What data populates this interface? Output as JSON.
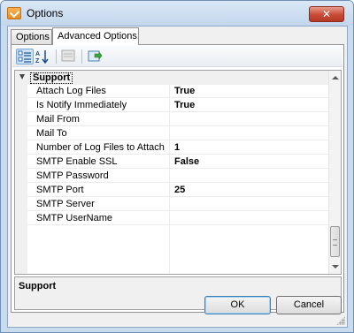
{
  "window": {
    "title": "Options",
    "close_glyph": "✕"
  },
  "tabs": [
    {
      "label": "Options",
      "active": false
    },
    {
      "label": "Advanced Options",
      "active": true
    }
  ],
  "toolbar": {
    "buttons": [
      {
        "icon": "categorized-icon",
        "pressed": true
      },
      {
        "icon": "alphabetical-sort-icon",
        "pressed": false
      },
      {
        "icon": "property-pages-icon",
        "pressed": false,
        "disabled": true
      },
      {
        "icon": "export-icon",
        "pressed": false
      }
    ]
  },
  "property_grid": {
    "category": "Support",
    "properties": [
      {
        "name": "Attach Log Files",
        "value": "True"
      },
      {
        "name": "Is Notify Immediately",
        "value": "True"
      },
      {
        "name": "Mail From",
        "value": ""
      },
      {
        "name": "Mail To",
        "value": ""
      },
      {
        "name": "Number of Log Files to Attach",
        "value": "1"
      },
      {
        "name": "SMTP Enable SSL",
        "value": "False"
      },
      {
        "name": "SMTP Password",
        "value": ""
      },
      {
        "name": "SMTP Port",
        "value": "25"
      },
      {
        "name": "SMTP Server",
        "value": ""
      },
      {
        "name": "SMTP UserName",
        "value": ""
      }
    ]
  },
  "description": {
    "title": "Support"
  },
  "buttons": {
    "ok_label": "OK",
    "cancel_label": "Cancel"
  },
  "colors": {
    "title_bar": "#c9dbee",
    "close_button": "#c84a36",
    "selection_border": "#3c7fb1"
  }
}
